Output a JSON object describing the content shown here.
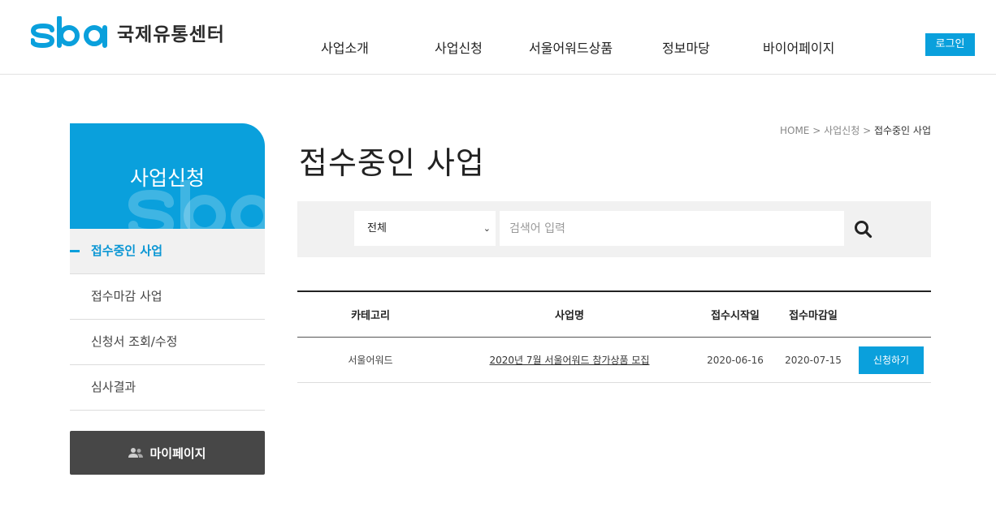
{
  "brand": {
    "logo_text": "국제유통센터",
    "accent_color": "#0aa0dc"
  },
  "nav": {
    "items": [
      {
        "label": "사업소개"
      },
      {
        "label": "사업신청"
      },
      {
        "label": "서울어워드상품"
      },
      {
        "label": "정보마당"
      },
      {
        "label": "바이어페이지"
      }
    ],
    "login_label": "로그인"
  },
  "sidebar": {
    "title": "사업신청",
    "items": [
      {
        "label": "접수중인 사업",
        "active": true
      },
      {
        "label": "접수마감 사업",
        "active": false
      },
      {
        "label": "신청서 조회/수정",
        "active": false
      },
      {
        "label": "심사결과",
        "active": false
      }
    ],
    "mypage_label": "마이페이지",
    "mypage_icon": "users-icon"
  },
  "breadcrumb": {
    "home": "HOME",
    "sep": " > ",
    "parent": "사업신청",
    "current": "접수중인 사업"
  },
  "page": {
    "title": "접수중인 사업"
  },
  "search": {
    "category_selected": "전체",
    "placeholder": "검색어 입력",
    "button_icon": "search-icon"
  },
  "table": {
    "headers": {
      "category": "카테고리",
      "name": "사업명",
      "start": "접수시작일",
      "end": "접수마감일"
    },
    "rows": [
      {
        "category": "서울어워드",
        "name": "2020년 7월 서울어워드 참가상품 모집",
        "start": "2020-06-16",
        "end": "2020-07-15",
        "action": "신청하기"
      }
    ]
  }
}
